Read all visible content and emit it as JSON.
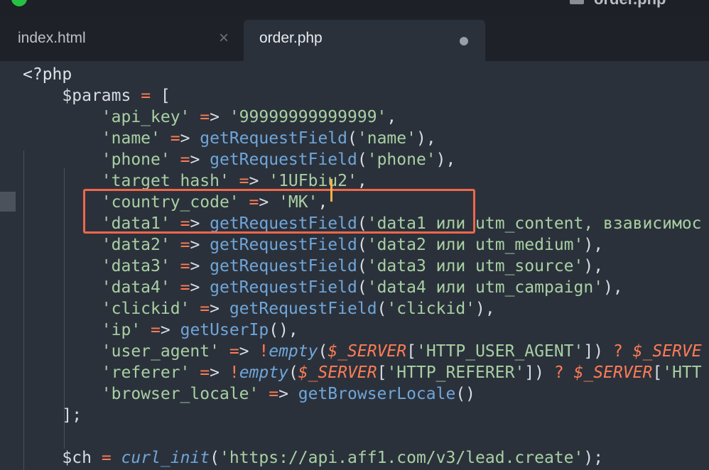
{
  "window": {
    "title": "order.php"
  },
  "tabs": [
    {
      "label": "index.html",
      "state": "inactive",
      "close_glyph": "×"
    },
    {
      "label": "order.php",
      "state": "active-modified"
    }
  ],
  "editor": {
    "language": "PHP",
    "lines": [
      "<?php",
      "    $params = [",
      "        'api_key' => '99999999999999',",
      "        'name' => getRequestField('name'),",
      "        'phone' => getRequestField('phone'),",
      "        'target_hash' => '1UFbiu2',",
      "        'country_code' => 'MK',",
      "        'data1' => getRequestField('data1 или utm_content, взависимос",
      "        'data2' => getRequestField('data2 или utm_medium'),",
      "        'data3' => getRequestField('data3 или utm_source'),",
      "        'data4' => getRequestField('data4 или utm_campaign'),",
      "        'clickid' => getRequestField('clickid'),",
      "        'ip' => getUserIp(),",
      "        'user_agent' => !empty($_SERVER['HTTP_USER_AGENT']) ? $_SERVE",
      "        'referer' => !empty($_SERVER['HTTP_REFERER']) ? $_SERVER['HTT",
      "        'browser_locale' => getBrowserLocale()",
      "    ];",
      "",
      "    $ch = curl_init('https://api.aff1.com/v3/lead.create');"
    ],
    "highlighted_lines": [
      "'name' => getRequestField('name'),",
      "'phone' => getRequestField('phone'),"
    ],
    "colors": {
      "background": "#2b313b",
      "string": "#a8d0a3",
      "function": "#6fa6d9",
      "keyword": "#ff7c55",
      "highlight_border": "#f0674b",
      "cursor": "#f4b14a"
    }
  }
}
